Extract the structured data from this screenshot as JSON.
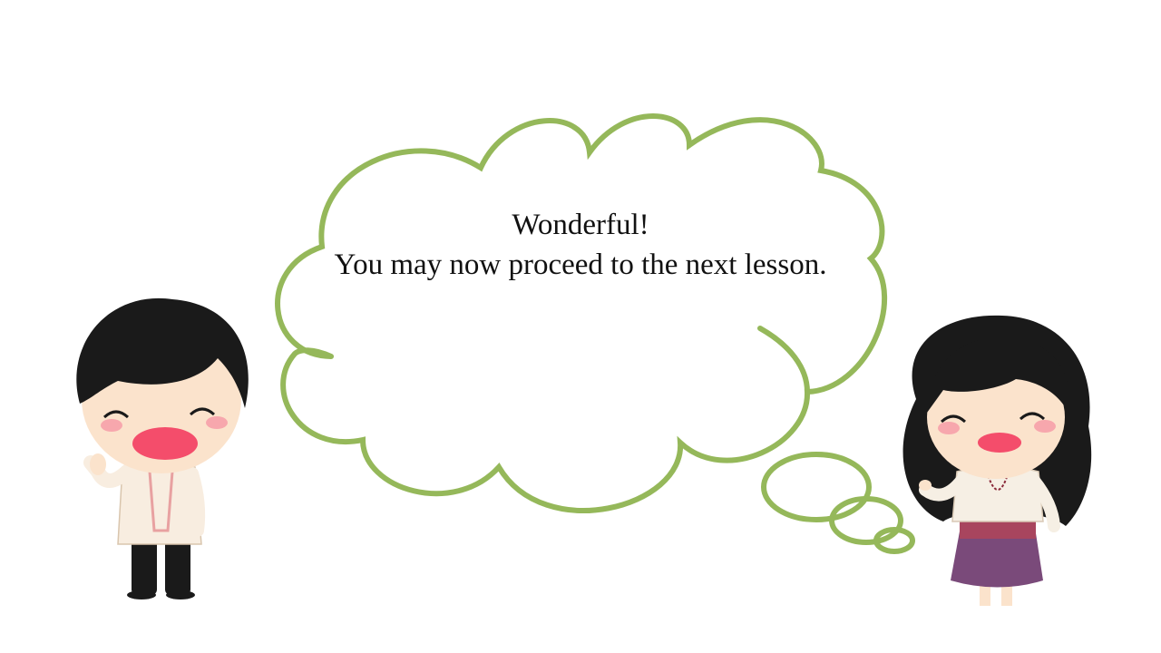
{
  "slide": {
    "message_line1": "Wonderful!",
    "message_line2": "You may now proceed to the next lesson."
  },
  "characters": [
    {
      "name": "boy",
      "pose": "waving",
      "outfit": "barong"
    },
    {
      "name": "girl",
      "pose": "waving",
      "outfit": "filipiniana"
    }
  ],
  "colors": {
    "bubble_outline": "#95b85a",
    "background": "#ffffff",
    "hair": "#1a1a1a",
    "skin": "#fbe3cc",
    "mouth": "#f44d6b",
    "cheek": "#f7a7ad",
    "skirt": "#7a4a7a"
  }
}
